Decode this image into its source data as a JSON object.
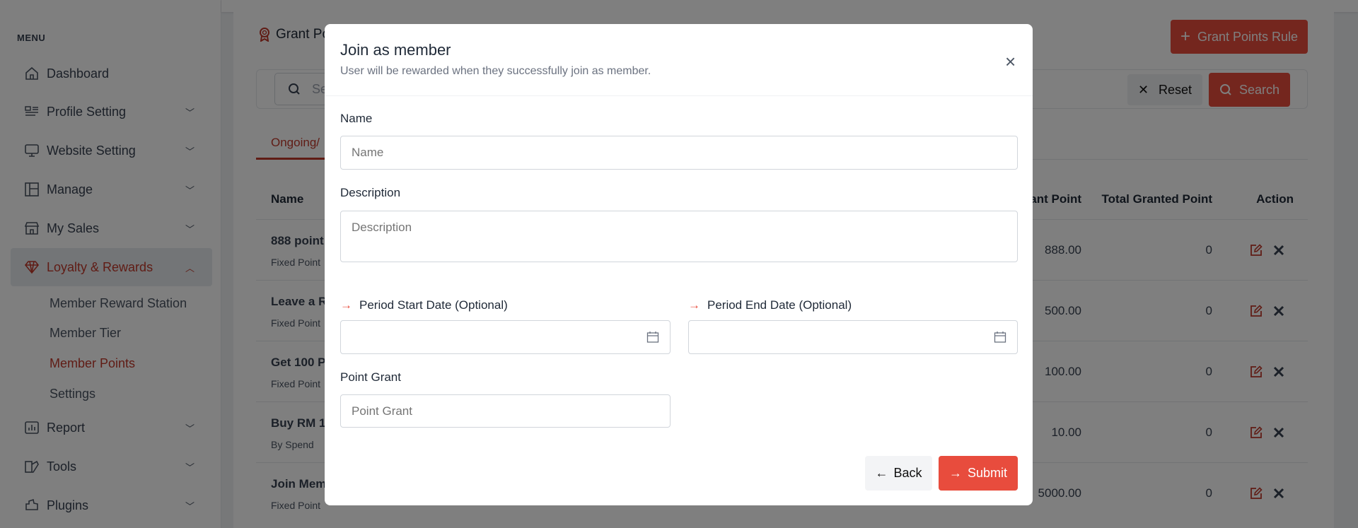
{
  "colors": {
    "accent": "#e84c3d",
    "active": "#c0392b"
  },
  "sidebar": {
    "menu_heading": "MENU",
    "items": [
      {
        "label": "Dashboard",
        "icon": "home-icon",
        "chevron": false
      },
      {
        "label": "Profile Setting",
        "icon": "profile-list-icon",
        "chevron": true
      },
      {
        "label": "Website Setting",
        "icon": "monitor-icon",
        "chevron": true
      },
      {
        "label": "Manage",
        "icon": "layout-icon",
        "chevron": true
      },
      {
        "label": "My Sales",
        "icon": "store-icon",
        "chevron": true
      },
      {
        "label": "Loyalty & Rewards",
        "icon": "diamond-icon",
        "chevron": true,
        "expanded": true,
        "active": true
      },
      {
        "label": "Report",
        "icon": "report-chart-icon",
        "chevron": true
      },
      {
        "label": "Tools",
        "icon": "tools-icon",
        "chevron": true
      },
      {
        "label": "Plugins",
        "icon": "plugin-icon",
        "chevron": true
      }
    ],
    "subitems": [
      {
        "label": "Member Reward Station"
      },
      {
        "label": "Member Tier"
      },
      {
        "label": "Member Points",
        "active": true
      },
      {
        "label": "Settings"
      }
    ]
  },
  "main": {
    "title": "Grant Po",
    "grant_button": "Grant Points Rule",
    "search_placeholder": "Se",
    "reset_label": "Reset",
    "search_label": "Search",
    "tab": "Ongoing/",
    "table": {
      "headers": {
        "name": "Name",
        "grant": "Grant Point",
        "total": "Total Granted Point",
        "action": "Action"
      },
      "rows": [
        {
          "name": "888 point",
          "type": "Fixed Point",
          "grant": "888.00",
          "total": "0"
        },
        {
          "name": "Leave a R",
          "type": "Fixed Point",
          "grant": "500.00",
          "total": "0"
        },
        {
          "name": "Get 100 P",
          "type": "Fixed Point",
          "grant": "100.00",
          "total": "0"
        },
        {
          "name": "Buy RM 1",
          "type": "By Spend",
          "grant": "10.00",
          "total": "0"
        },
        {
          "name": "Join Mem",
          "type": "Fixed Point",
          "grant": "5000.00",
          "total": "0"
        }
      ]
    }
  },
  "modal": {
    "title": "Join as member",
    "subtitle": "User will be rewarded when they successfully join as member.",
    "name_label": "Name",
    "name_placeholder": "Name",
    "name_value": "",
    "description_label": "Description",
    "description_placeholder": "Description",
    "description_value": "",
    "start_label": "Period Start Date (Optional)",
    "start_value": "",
    "end_label": "Period End Date (Optional)",
    "end_value": "",
    "point_label": "Point Grant",
    "point_placeholder": "Point Grant",
    "point_value": "",
    "back_label": "Back",
    "submit_label": "Submit"
  }
}
